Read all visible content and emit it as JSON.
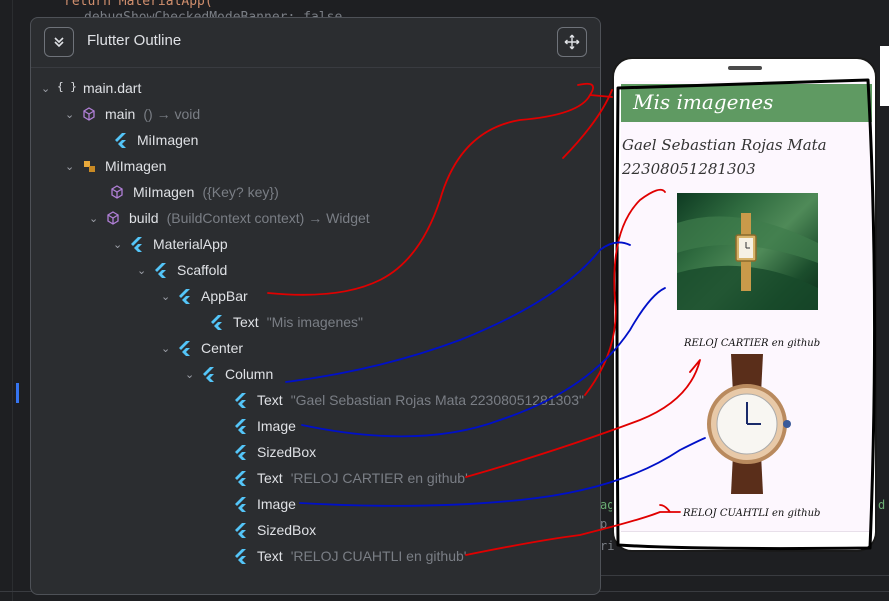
{
  "editor": {
    "code_top": "return MaterialApp(",
    "code_second": "debugShowCheckedModeBanner: false,",
    "side_a": "ag",
    "side_b": "p",
    "side_c": "ri",
    "side_d": "d"
  },
  "outline": {
    "title": "Flutter Outline",
    "collapse_icon": "collapse-all-icon",
    "move_icon": "move-arrows-icon",
    "items": [
      {
        "label": "main.dart",
        "sig": ""
      },
      {
        "label": "main",
        "sig": "() → void"
      },
      {
        "label": "MiImagen",
        "sig": ""
      },
      {
        "label": "MiImagen",
        "sig": ""
      },
      {
        "label": "MiImagen",
        "sig": "({Key? key})"
      },
      {
        "label": "build",
        "sig": "(BuildContext context) → Widget"
      },
      {
        "label": "MaterialApp",
        "sig": ""
      },
      {
        "label": "Scaffold",
        "sig": ""
      },
      {
        "label": "AppBar",
        "sig": ""
      },
      {
        "label": "Text",
        "sig": "\"Mis imagenes\""
      },
      {
        "label": "Center",
        "sig": ""
      },
      {
        "label": "Column",
        "sig": ""
      },
      {
        "label": "Text",
        "sig": "\"Gael Sebastian Rojas Mata 22308051281303\""
      },
      {
        "label": "Image",
        "sig": ""
      },
      {
        "label": "SizedBox",
        "sig": ""
      },
      {
        "label": "Text",
        "sig": "'RELOJ CARTIER en github'"
      },
      {
        "label": "Image",
        "sig": ""
      },
      {
        "label": "SizedBox",
        "sig": ""
      },
      {
        "label": "Text",
        "sig": "'RELOJ CUAHTLI en github'"
      }
    ]
  },
  "phone": {
    "appbar_title": "Mis imagenes",
    "name_line1": "Gael Sebastian Rojas Mata",
    "name_line2": "22308051281303",
    "caption1": "RELOJ CARTIER en github",
    "caption2": "RELOJ CUAHTLI en github",
    "appbar_color": "#5f9a62",
    "screen_color": "#fdf7fe"
  },
  "colors": {
    "accent_red": "#e00000",
    "accent_blue": "#0010c8",
    "flutter_blue": "#54c5f8",
    "method_purple": "#b07fd6",
    "class_orange": "#e8a93b"
  }
}
